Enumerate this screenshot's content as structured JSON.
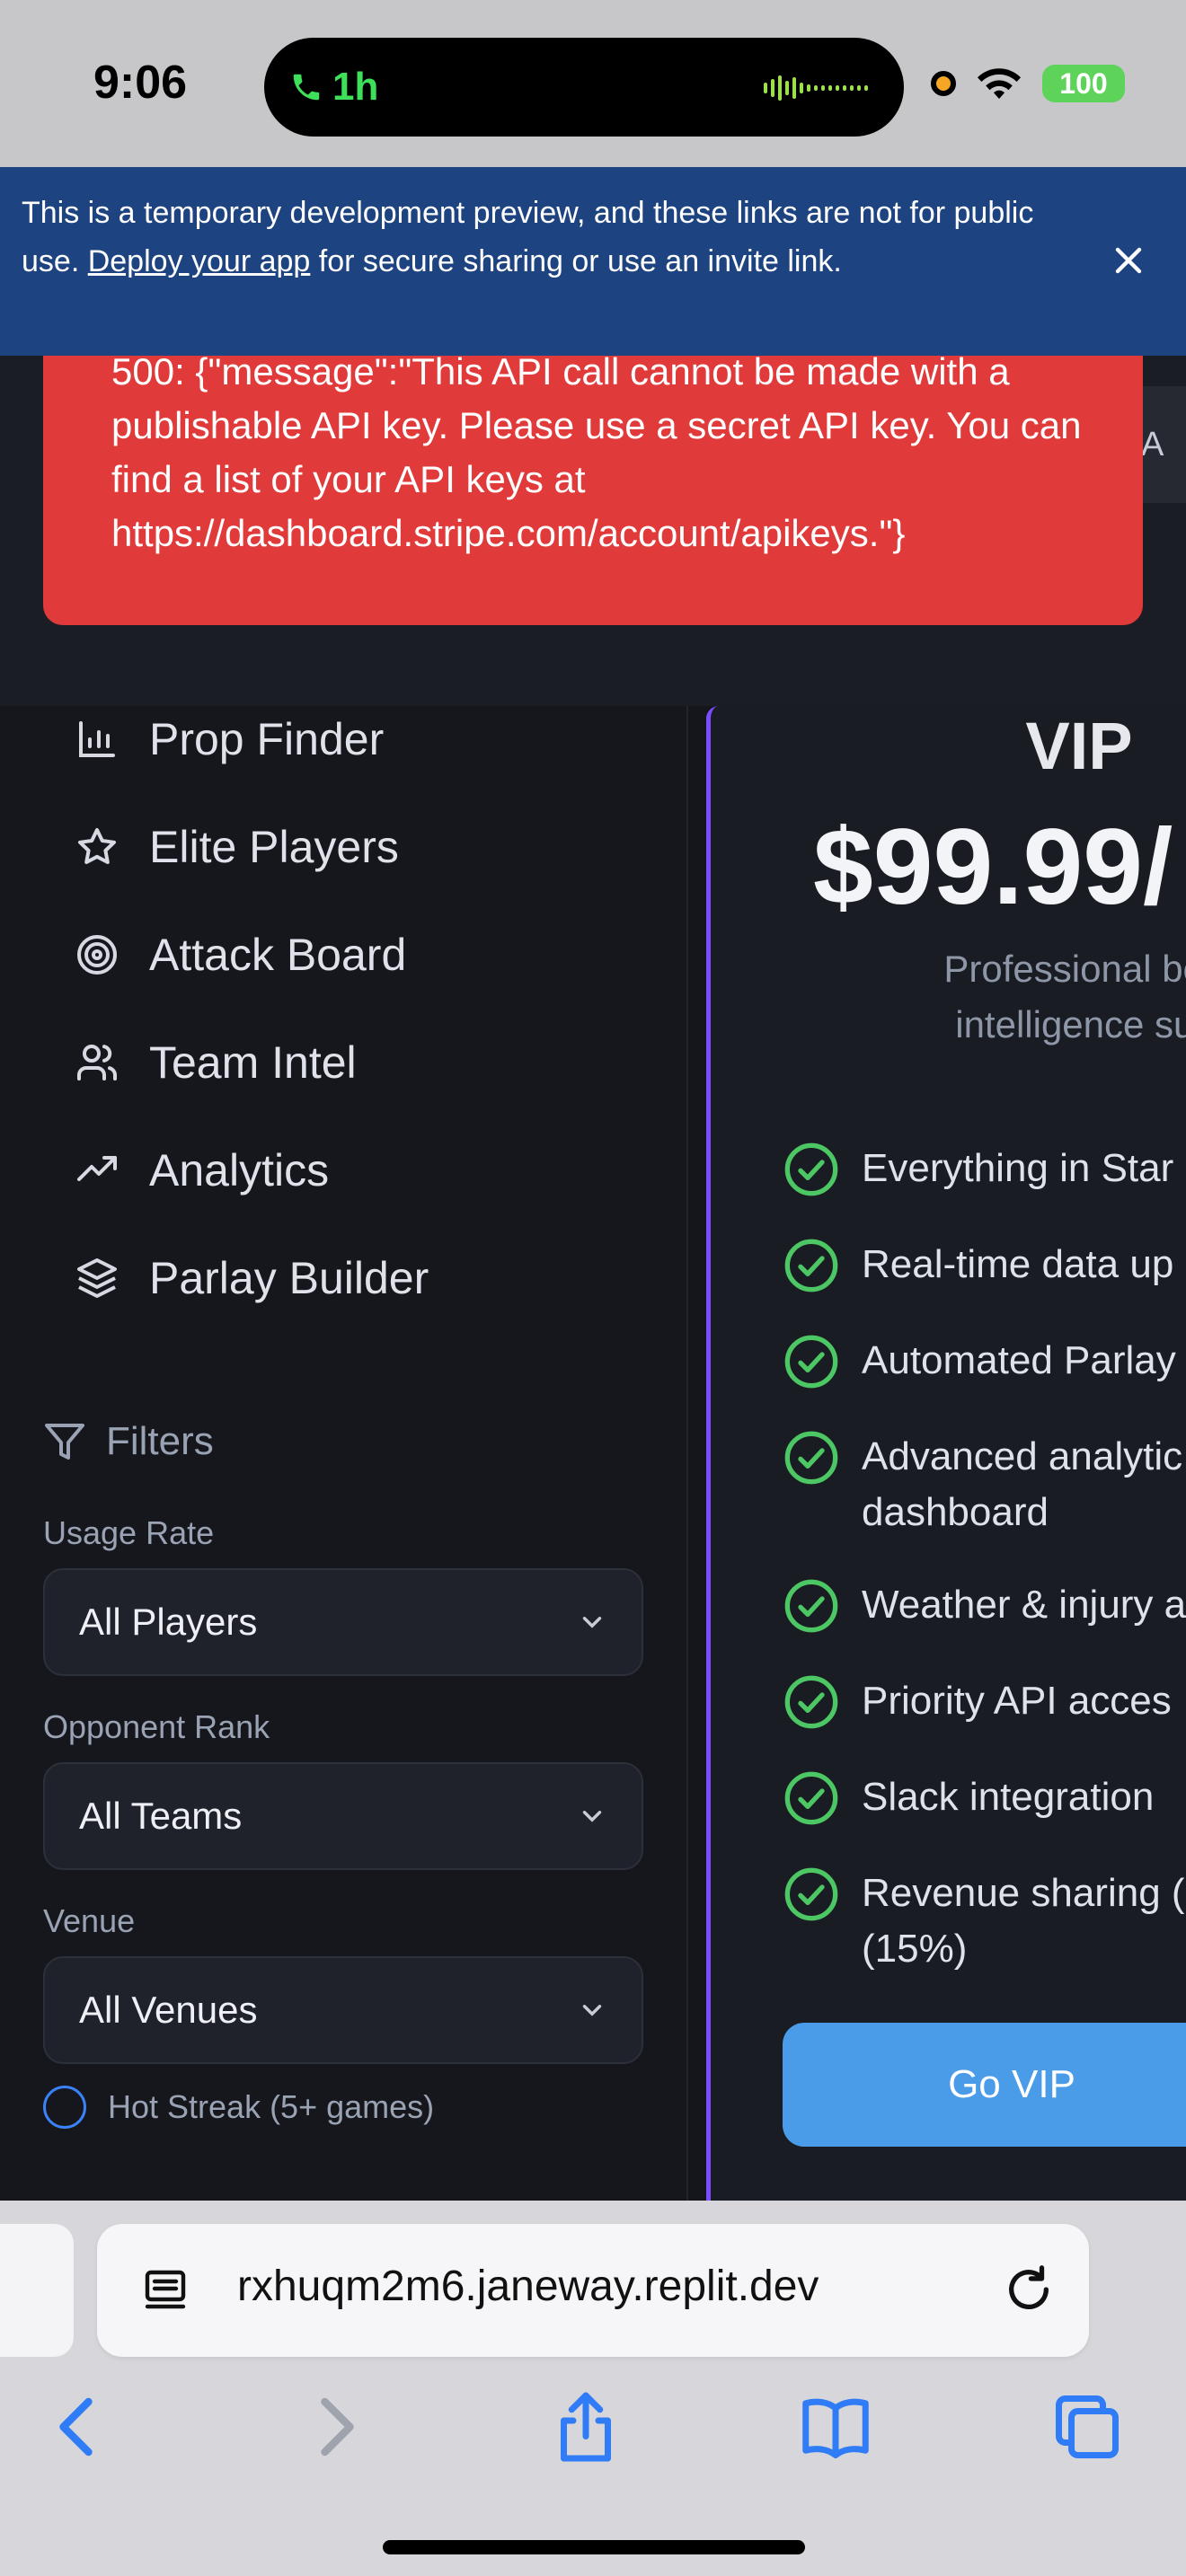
{
  "status_bar": {
    "time": "9:06",
    "call_duration": "1h",
    "battery": "100"
  },
  "dev_banner": {
    "text_before": "This is a temporary development preview, and these links are not for public use. ",
    "link": "Deploy your app",
    "text_after": " for secure sharing or use an invite link."
  },
  "error": {
    "message": "500: {\"message\":\"This API call cannot be made with a publishable API key. Please use a secret API key. You can find a list of your API keys at https://dashboard.stripe.com/account/apikeys.\"}"
  },
  "top_strip": {
    "button_fragment": "A"
  },
  "sidebar": {
    "nav": [
      {
        "label": "Prop Finder",
        "icon": "bar-chart-icon"
      },
      {
        "label": "Elite Players",
        "icon": "star-icon"
      },
      {
        "label": "Attack Board",
        "icon": "target-icon"
      },
      {
        "label": "Team Intel",
        "icon": "users-icon"
      },
      {
        "label": "Analytics",
        "icon": "trending-up-icon"
      },
      {
        "label": "Parlay Builder",
        "icon": "layers-icon"
      }
    ],
    "filters": {
      "heading": "Filters",
      "usage_rate": {
        "label": "Usage Rate",
        "value": "All Players"
      },
      "opponent_rank": {
        "label": "Opponent Rank",
        "value": "All Teams"
      },
      "venue": {
        "label": "Venue",
        "value": "All Venues"
      },
      "hot_streak": {
        "label": "Hot Streak (5+ games)",
        "checked": false
      }
    }
  },
  "vip_plan": {
    "title": "VIP",
    "price": "$99.99/",
    "description_line1": "Professional bet",
    "description_line2": "intelligence sui",
    "features": [
      "Everything in Star",
      "Real-time data up",
      "Automated Parlay",
      "Advanced analytic",
      "dashboard",
      "Weather & injury a",
      "Priority API acces",
      "Slack integration",
      "Revenue sharing (",
      "(15%)"
    ],
    "cta": "Go VIP",
    "accent_color": "#7c4dff",
    "check_color": "#4cc764"
  },
  "browser": {
    "url": "rxhuqm2m6.janeway.replit.dev"
  }
}
